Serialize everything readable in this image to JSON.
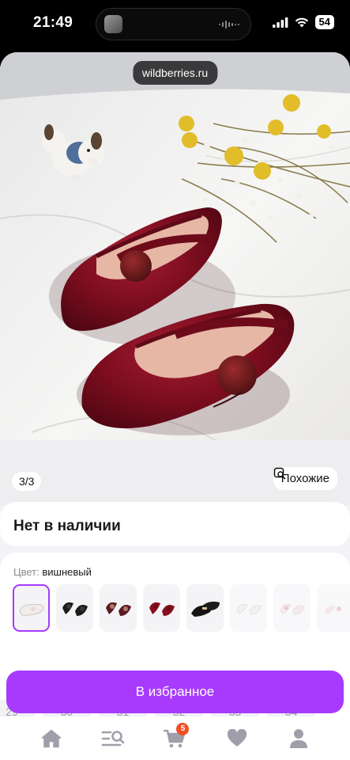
{
  "status_bar": {
    "time": "21:49",
    "battery": "54"
  },
  "browser": {
    "url": "wildberries.ru"
  },
  "gallery": {
    "counter": "3/3",
    "similar_label": "Похожие"
  },
  "product": {
    "availability": "Нет в наличии"
  },
  "color": {
    "label": "Цвет:",
    "value": "вишневый",
    "swatch_count": 8,
    "selected_index": 0
  },
  "sizes": [
    "29",
    "30",
    "31",
    "32",
    "33",
    "34"
  ],
  "actions": {
    "favorite_label": "В избранное"
  },
  "nav": {
    "cart_badge": "5"
  },
  "colors": {
    "accent": "#a73afd",
    "badge": "#f04e23",
    "velvet": "#7a0d1e"
  }
}
